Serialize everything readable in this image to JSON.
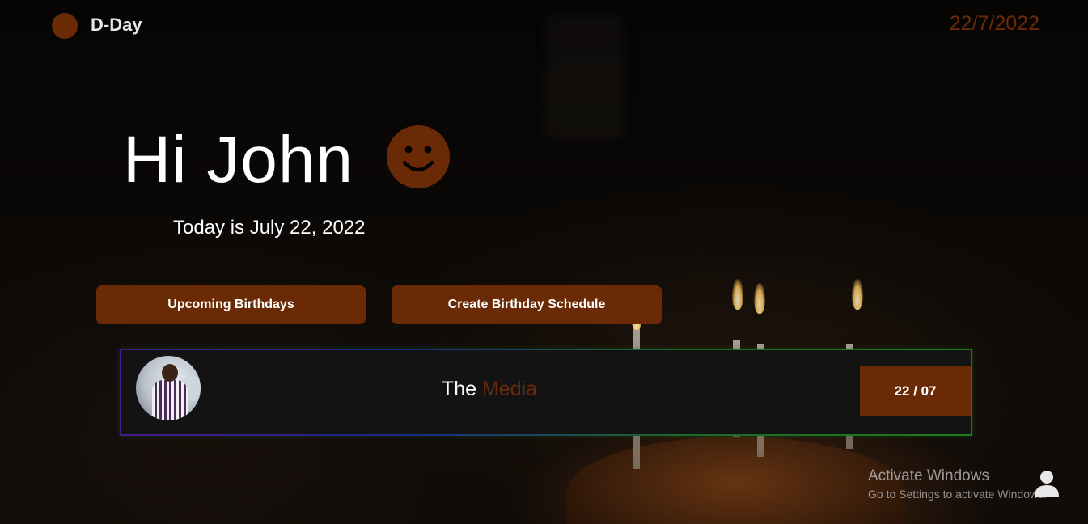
{
  "header": {
    "brand": "D-Day",
    "date": "22/7/2022"
  },
  "greeting": {
    "title": "Hi John",
    "today_text": "Today is July 22, 2022",
    "icon": "smiley-face-icon"
  },
  "actions": {
    "upcoming_label": "Upcoming Birthdays",
    "create_label": "Create Birthday Schedule"
  },
  "birthday_card": {
    "name_prefix": "The",
    "name_accent": "Media",
    "date": "22 / 07"
  },
  "watermark": {
    "title": "Activate Windows",
    "subtitle": "Go to Settings to activate Windows."
  },
  "colors": {
    "accent": "#6a2a05",
    "card_bg": "#141313"
  }
}
